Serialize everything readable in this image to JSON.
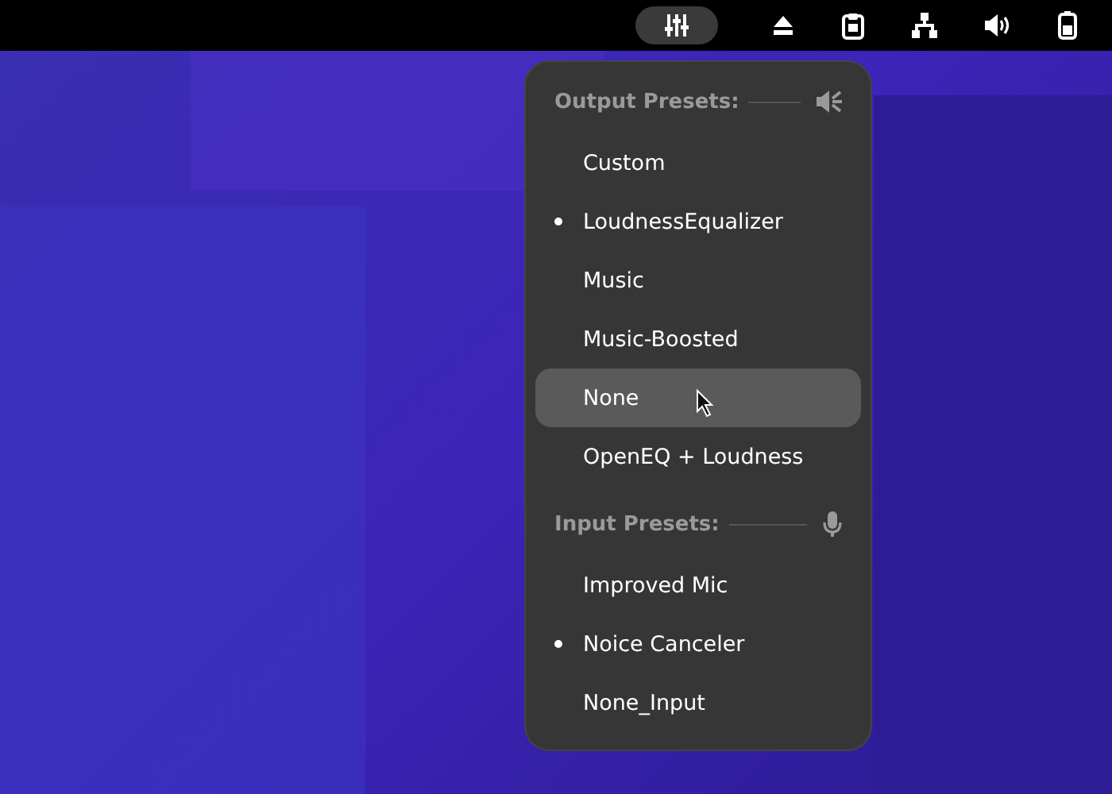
{
  "top_bar": {
    "indicators": [
      {
        "kind": "sliders",
        "active": true
      },
      {
        "kind": "eject",
        "active": false
      },
      {
        "kind": "clipboard",
        "active": false
      },
      {
        "kind": "network",
        "active": false
      },
      {
        "kind": "volume",
        "active": false
      },
      {
        "kind": "battery",
        "active": false
      }
    ]
  },
  "menu": {
    "sections": [
      {
        "title": "Output Presets:",
        "kind": "speaker",
        "items": [
          {
            "label": "Custom",
            "selected": false,
            "hovered": false
          },
          {
            "label": "LoudnessEqualizer",
            "selected": true,
            "hovered": false
          },
          {
            "label": "Music",
            "selected": false,
            "hovered": false
          },
          {
            "label": "Music-Boosted",
            "selected": false,
            "hovered": false
          },
          {
            "label": "None",
            "selected": false,
            "hovered": true
          },
          {
            "label": "OpenEQ + Loudness",
            "selected": false,
            "hovered": false
          }
        ]
      },
      {
        "title": "Input Presets:",
        "kind": "microphone",
        "items": [
          {
            "label": "Improved Mic",
            "selected": false,
            "hovered": false
          },
          {
            "label": "Noice Canceler",
            "selected": true,
            "hovered": false
          },
          {
            "label": "None_Input",
            "selected": false,
            "hovered": false
          }
        ]
      }
    ]
  }
}
